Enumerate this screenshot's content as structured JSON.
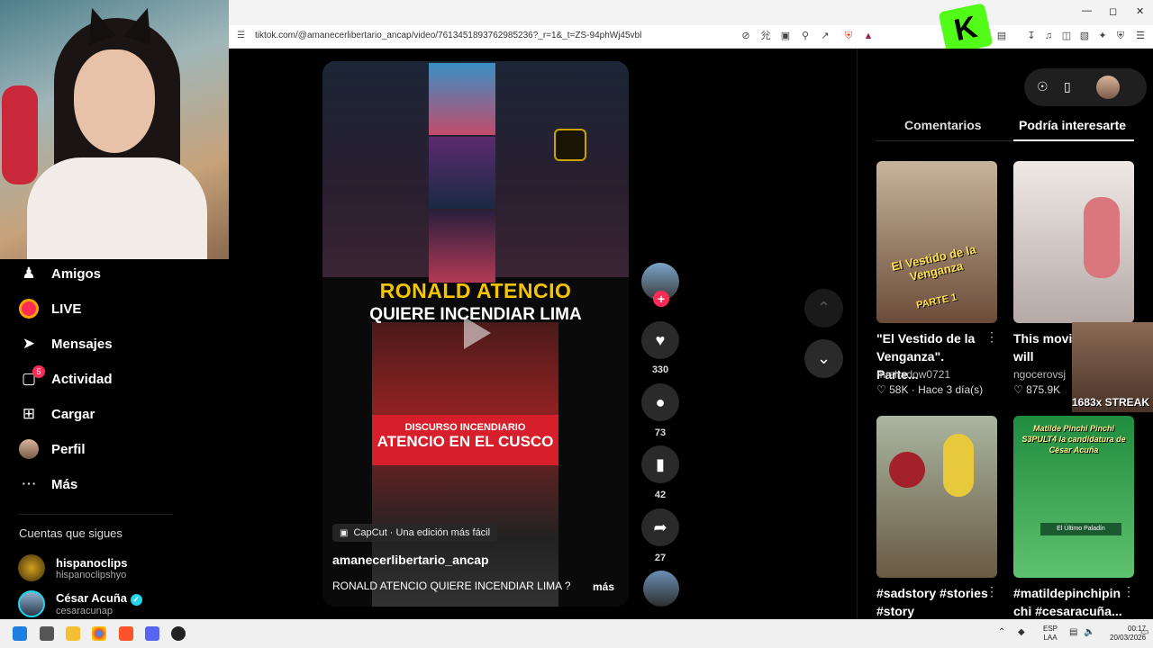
{
  "browser": {
    "url": "tiktok.com/@amanecerlibertario_ancap/video/7613451893762985236?_r=1&_t=ZS-94phWj45vbl"
  },
  "nav": {
    "items": [
      {
        "label": "Amigos",
        "icon": "friends-icon"
      },
      {
        "label": "LIVE",
        "icon": "live-icon"
      },
      {
        "label": "Mensajes",
        "icon": "messages-icon"
      },
      {
        "label": "Actividad",
        "icon": "activity-icon",
        "badge": "5"
      },
      {
        "label": "Cargar",
        "icon": "upload-icon"
      },
      {
        "label": "Perfil",
        "icon": "profile-avatar"
      },
      {
        "label": "Más",
        "icon": "more-icon"
      }
    ],
    "following_title": "Cuentas que sigues",
    "following": [
      {
        "name": "hispanoclips",
        "handle": "hispanoclipshyo"
      },
      {
        "name": "César Acuña",
        "handle": "cesaracunap",
        "verified": true
      }
    ]
  },
  "video": {
    "headline1": "RONALD ATENCIO",
    "headline2": "QUIERE INCENDIAR LIMA",
    "banner_line1": "DISCURSO INCENDIARIO",
    "banner_line2": "ATENCIO EN EL CUSCO",
    "capcut": "CapCut · Una edición más fácil",
    "author": "amanecerlibertario_ancap",
    "caption": "RONALD ATENCIO QUIERE INCENDIAR LIMA ?",
    "more": "más"
  },
  "actions": {
    "likes": "330",
    "comments": "73",
    "saves": "42",
    "shares": "27"
  },
  "right_panel": {
    "tabs": [
      "Comentarios",
      "Podría interesarte"
    ],
    "active_tab": "Podría interesarte",
    "cards": [
      {
        "title": "\"El Vestido de la Venganza\". Parte...",
        "author": "mrshadow0721",
        "likes": "58K",
        "time": "Hace 3 día(s)",
        "thumb_text": "El Vestido de la Venganza",
        "thumb_sub": "PARTE 1"
      },
      {
        "title": "This movie ending will",
        "author": "ngocerovsj",
        "likes": "875.9K"
      },
      {
        "title": "#sadstory #stories #story #verduras..."
      },
      {
        "title": "#matildepinchipin chi #cesaracuña...",
        "thumb_text": "Matilde Pinchi Pinchi S3PULT4 la candidatura de César Acuña",
        "thumb_sub": "El Último Paladín"
      }
    ]
  },
  "overlay": {
    "streak": "1683x STREAK"
  },
  "taskbar": {
    "lang": "ESP\nLAA",
    "time": "00:17",
    "date": "20/03/2026"
  },
  "colors": {
    "accent": "#fe2c55",
    "headline_yellow": "#f7c400",
    "banner_red": "#d71e2b"
  }
}
